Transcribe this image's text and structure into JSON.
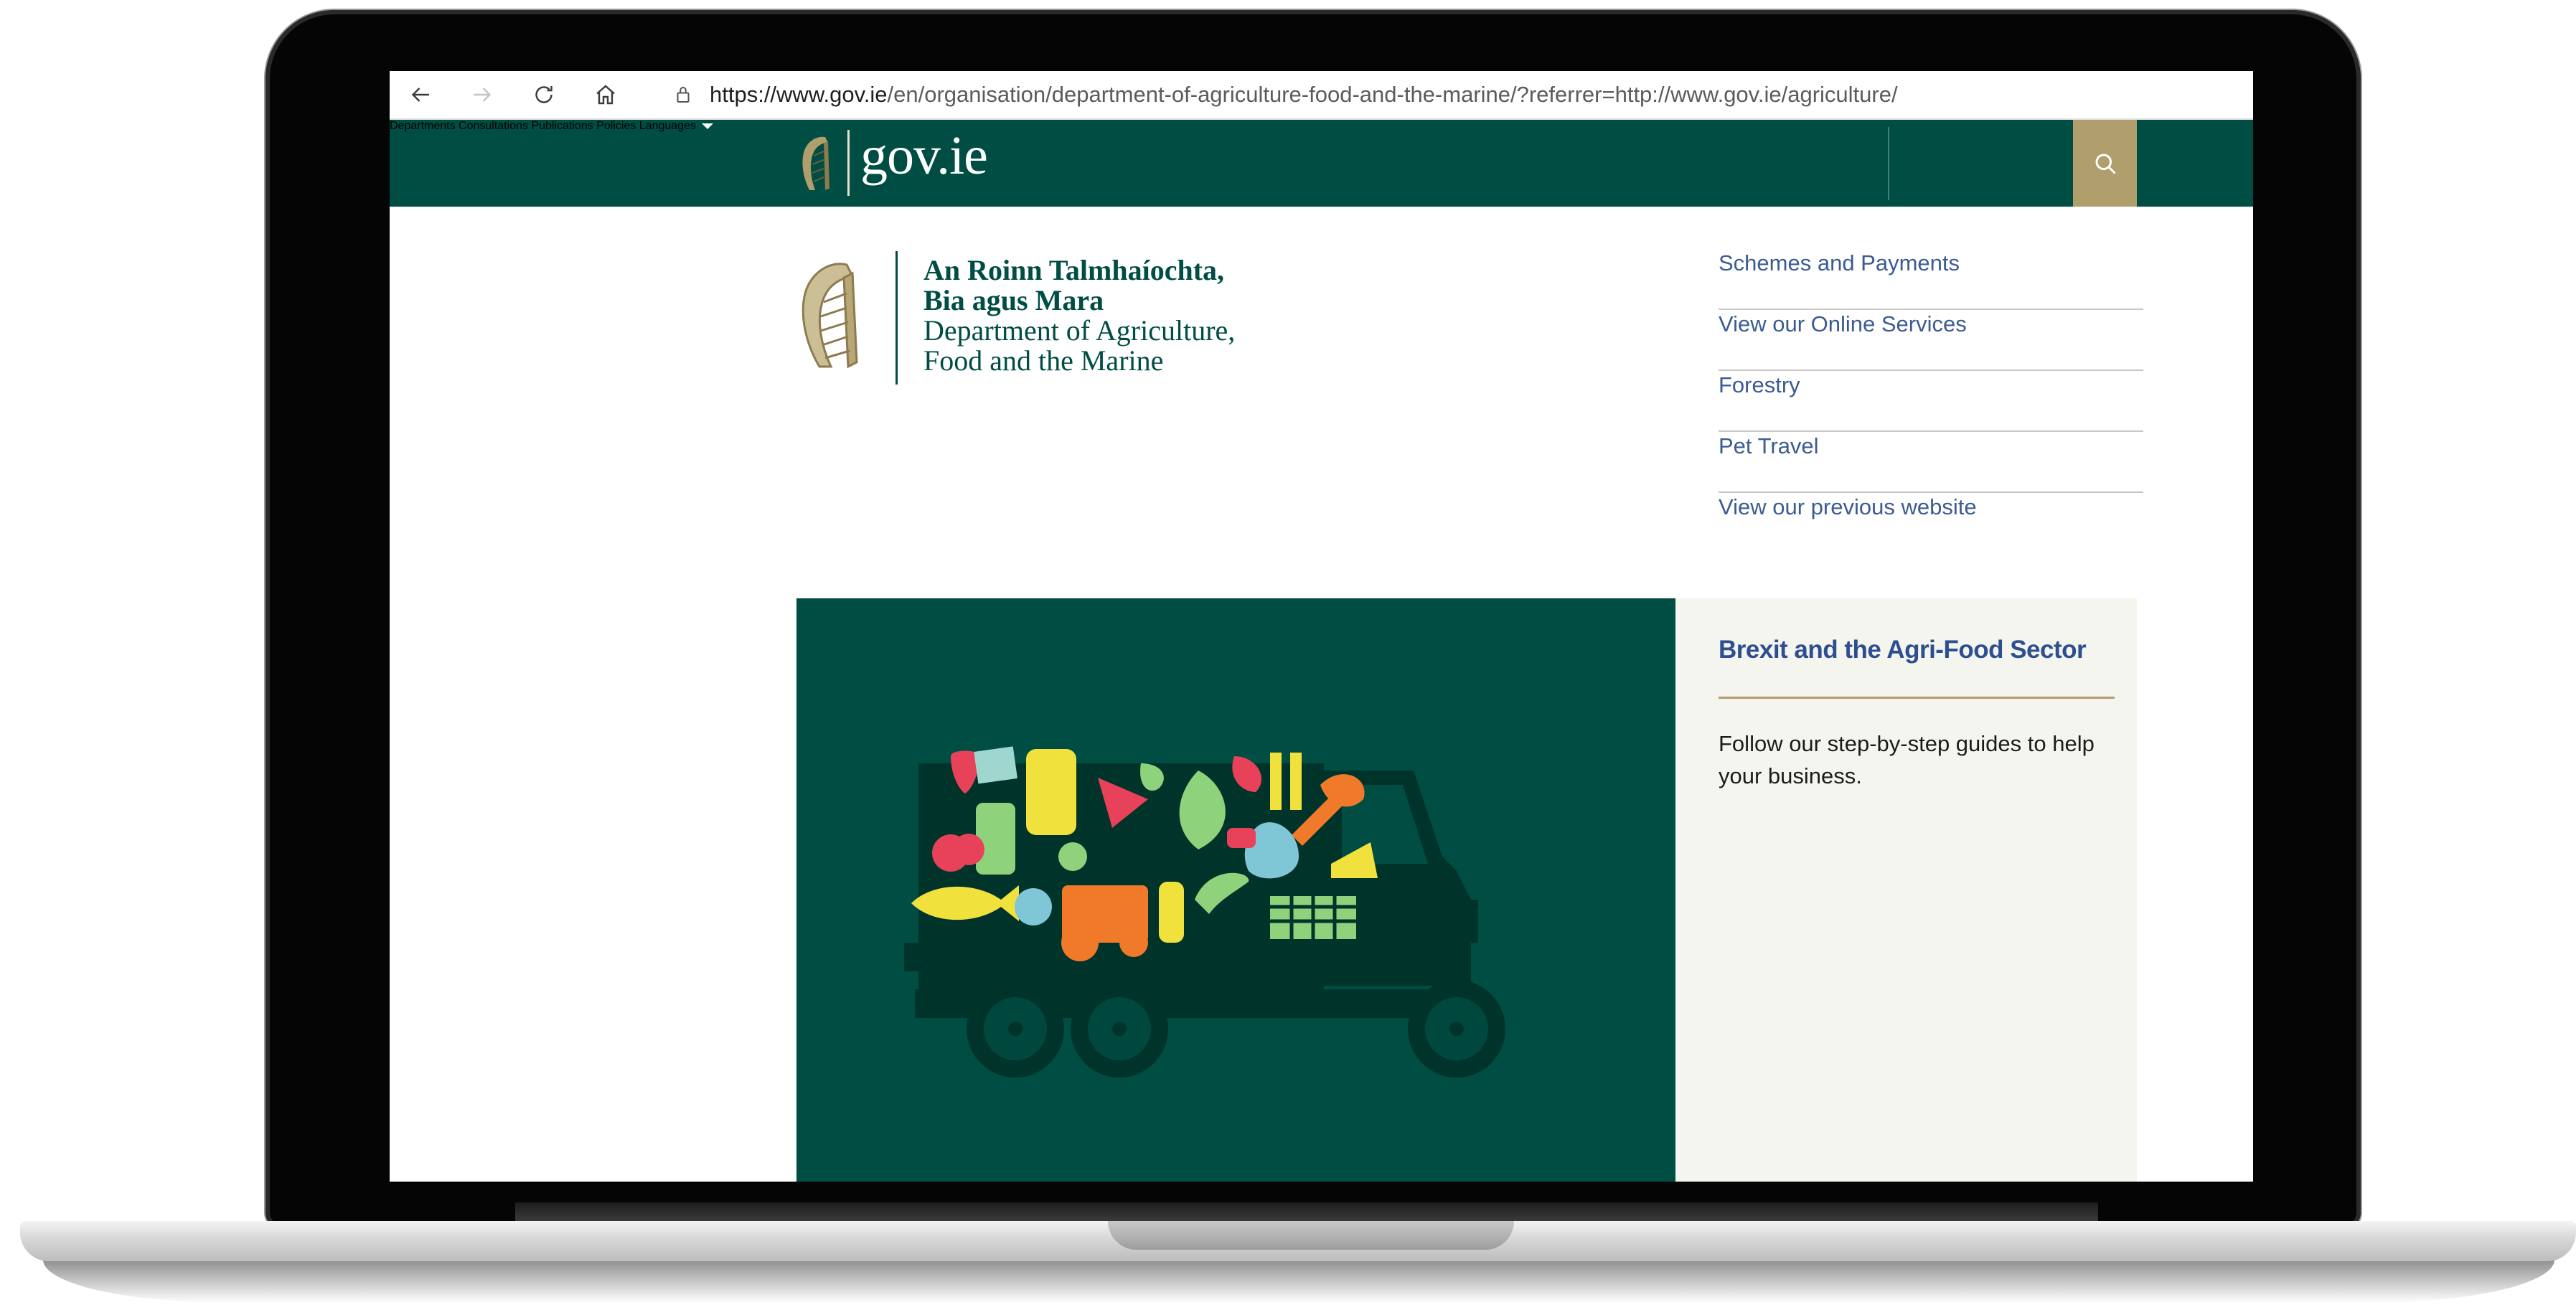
{
  "browser": {
    "url_host": "https://www.gov.ie",
    "url_path": "/en/organisation/department-of-agriculture-food-and-the-marine/?referrer=http://www.gov.ie/agriculture/",
    "back_icon": "back-arrow-icon",
    "forward_icon": "forward-arrow-icon",
    "reload_icon": "reload-icon",
    "home_icon": "home-icon",
    "lock_icon": "lock-icon"
  },
  "header": {
    "logo_text": "gov.ie",
    "nav": [
      "Departments",
      "Consultations",
      "Publications",
      "Policies"
    ],
    "languages_label": "Languages",
    "search_icon": "search-icon",
    "colors": {
      "background": "#004d44",
      "accent": "#b09e6d"
    }
  },
  "department": {
    "lines": [
      "An Roinn Talmhaíochta,",
      "Bia agus Mara",
      "Department of Agriculture,",
      "Food and the Marine"
    ]
  },
  "quick_links": [
    "Schemes and Payments",
    "View our Online Services",
    "Forestry",
    "Pet Travel",
    "View our previous website"
  ],
  "hero": {
    "image_alt_icon": "agri-food-truck-illustration",
    "title": "Brexit and the Agri-Food Sector",
    "text": "Follow our step-by-step guides to help your business."
  }
}
